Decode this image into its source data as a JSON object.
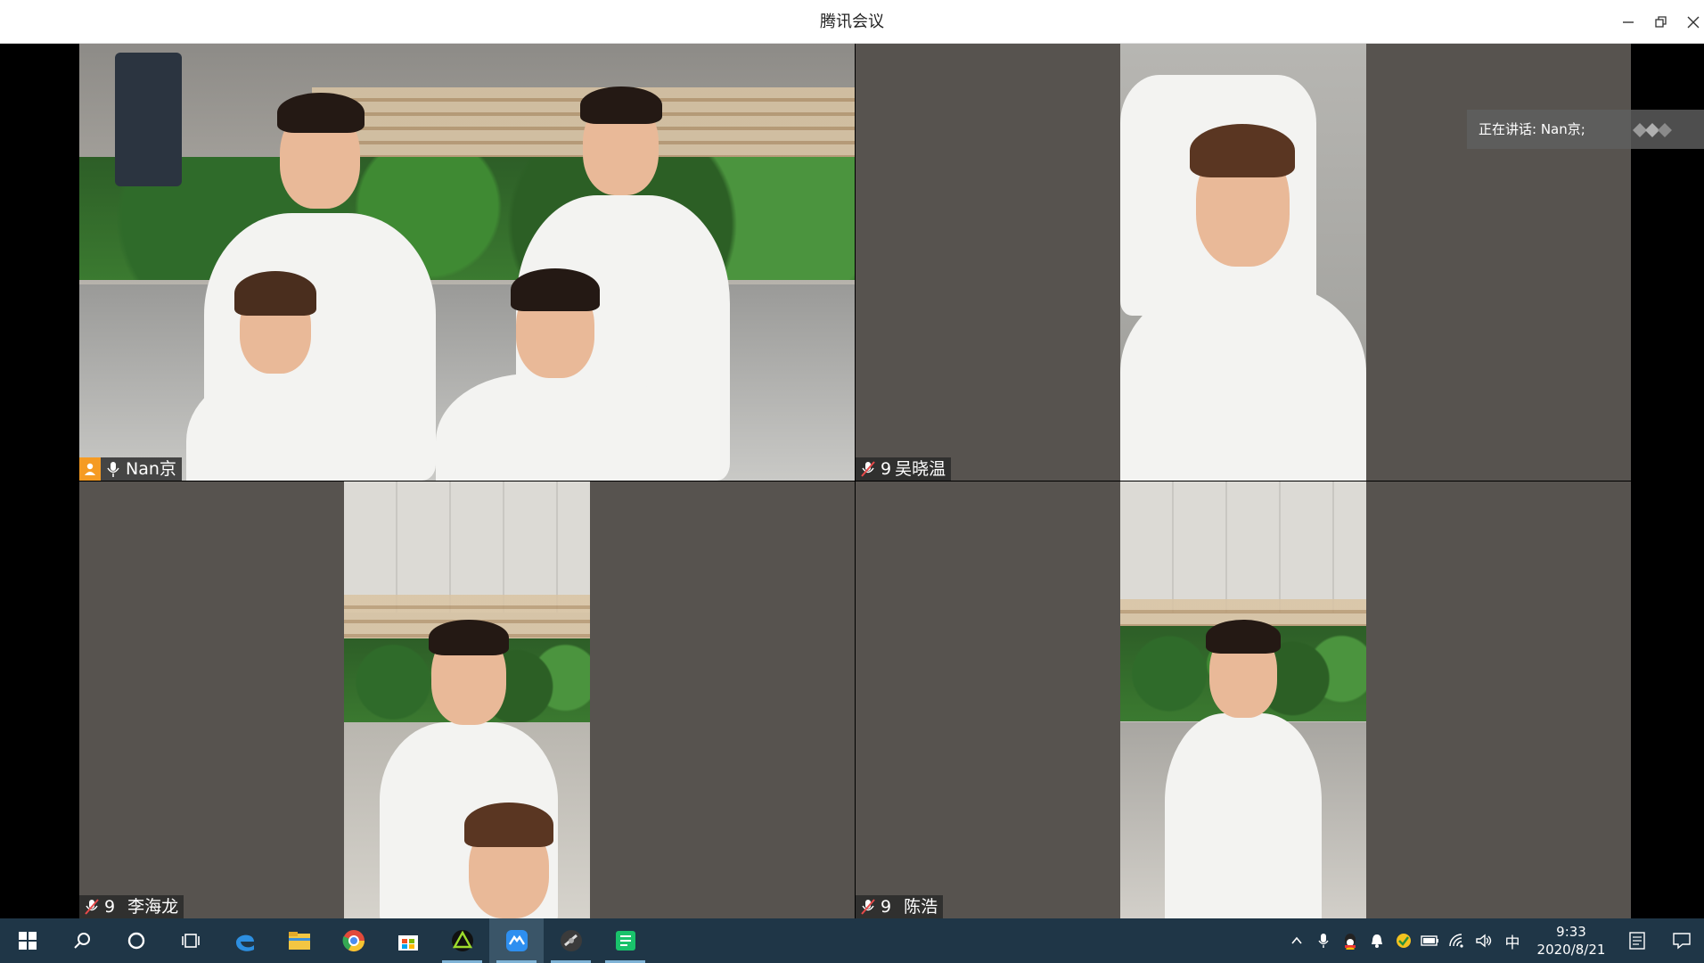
{
  "window": {
    "title": "腾讯会议",
    "minimize_icon": "minimize-icon",
    "restore_icon": "restore-icon",
    "close_icon": "close-icon"
  },
  "speaking_banner": {
    "text": "正在讲话: Nan京;"
  },
  "participants": [
    {
      "prefix": "",
      "name": "Nan京",
      "mic": "mic-on",
      "host": true,
      "active": true
    },
    {
      "prefix": "9",
      "name": "吴晓温",
      "mic": "mic-muted",
      "host": false,
      "active": false
    },
    {
      "prefix": "9",
      "name": "李海龙",
      "mic": "mic-muted",
      "host": false,
      "active": false
    },
    {
      "prefix": "9",
      "name": "陈浩",
      "mic": "mic-muted",
      "host": false,
      "active": false
    }
  ],
  "colors": {
    "active_border": "#3fb98c",
    "tile_bg": "#57534f",
    "taskbar_bg": "#1f3647",
    "host_badge": "#f59b23"
  },
  "taskbar": {
    "apps": [
      "windows-start-icon",
      "search-icon",
      "cortana-icon",
      "task-view-icon",
      "edge-icon",
      "file-explorer-icon",
      "chrome-icon",
      "store-icon",
      "app-icon",
      "tencent-meeting-icon",
      "media-icon",
      "wechat-work-icon"
    ],
    "tray": {
      "input_method": "中",
      "time": "9:33",
      "date": "2020/8/21"
    }
  }
}
